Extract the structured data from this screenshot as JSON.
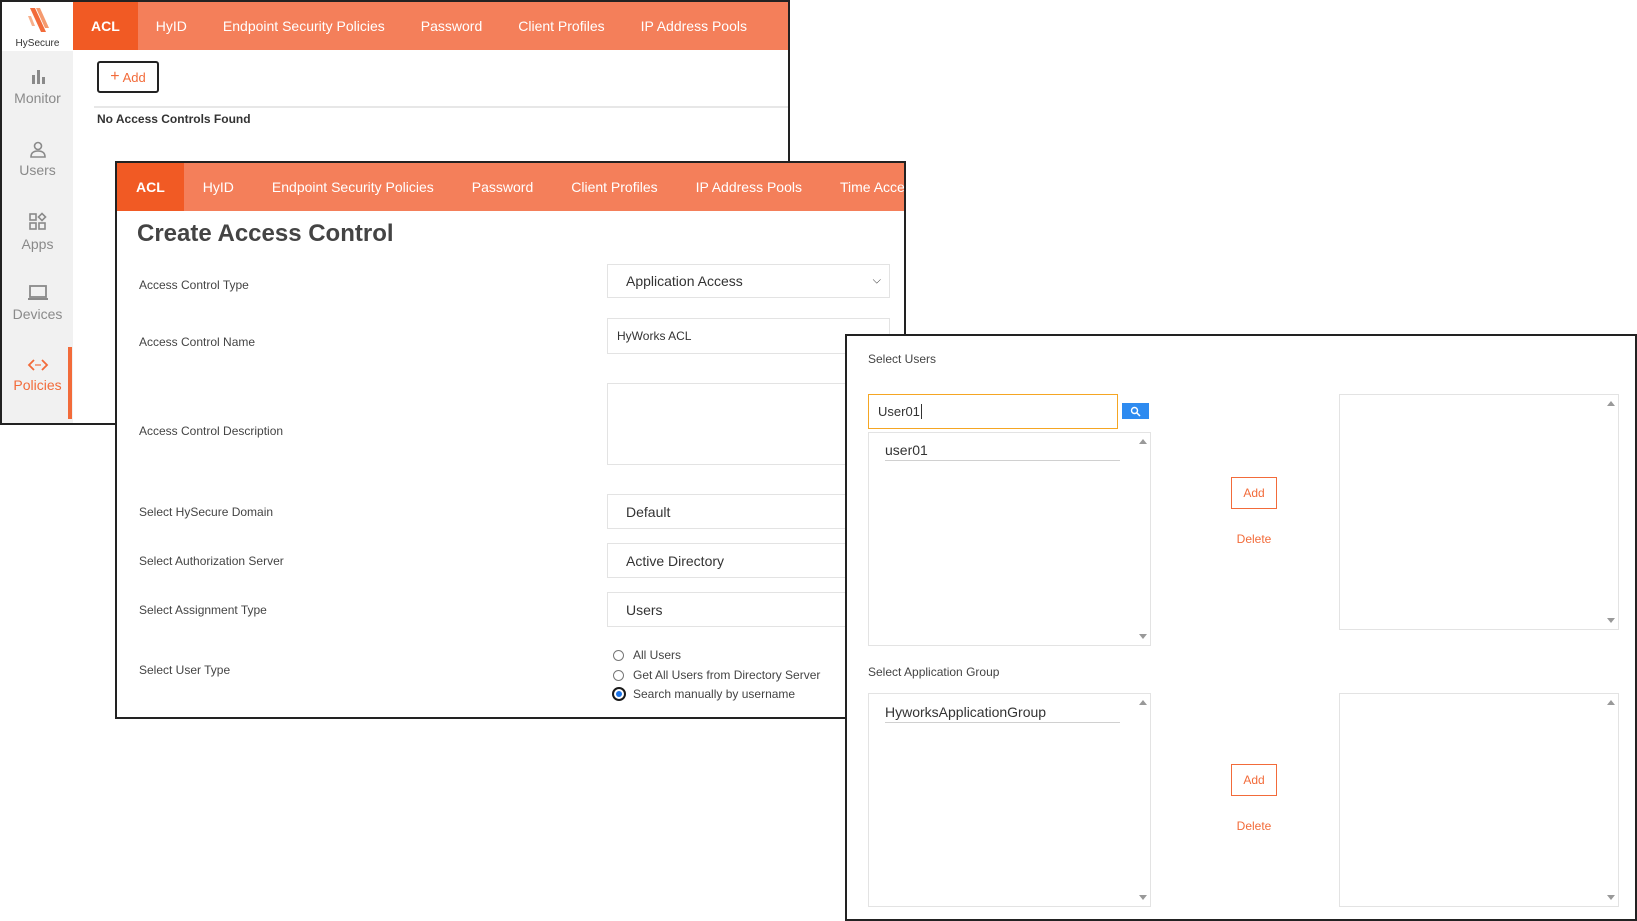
{
  "panel1": {
    "logo_text": "HySecure",
    "sidebar": [
      {
        "label": "Monitor",
        "icon": "bar-chart-icon"
      },
      {
        "label": "Users",
        "icon": "user-icon"
      },
      {
        "label": "Apps",
        "icon": "apps-icon"
      },
      {
        "label": "Devices",
        "icon": "laptop-icon"
      },
      {
        "label": "Policies",
        "icon": "code-arrows-icon",
        "active": true
      }
    ],
    "tabs": [
      "ACL",
      "HyID",
      "Endpoint Security Policies",
      "Password",
      "Client Profiles",
      "IP Address Pools"
    ],
    "add_button": "Add",
    "empty_message": "No Access Controls Found"
  },
  "panel2": {
    "tabs": [
      "ACL",
      "HyID",
      "Endpoint Security Policies",
      "Password",
      "Client Profiles",
      "IP Address Pools",
      "Time Acce"
    ],
    "title": "Create Access Control",
    "fields": {
      "type_label": "Access Control Type",
      "type_value": "Application Access",
      "name_label": "Access Control Name",
      "name_value": "HyWorks ACL",
      "desc_label": "Access Control Description",
      "domain_label": "Select HySecure Domain",
      "domain_value": "Default",
      "auth_label": "Select Authorization Server",
      "auth_value": "Active Directory",
      "assign_label": "Select Assignment Type",
      "assign_value": "Users",
      "usertype_label": "Select User Type"
    },
    "user_type_options": [
      "All Users",
      "Get All Users from Directory Server",
      "Search manually by username"
    ],
    "user_type_selected": "Search manually by username"
  },
  "panel3": {
    "select_users_label": "Select Users",
    "search_value": "User01",
    "search_results": [
      "user01"
    ],
    "add_label": "Add",
    "delete_label": "Delete",
    "select_group_label": "Select Application Group",
    "groups": [
      "HyworksApplicationGroup"
    ]
  },
  "colors": {
    "accent": "#f15a24",
    "tabbar": "#f47f5a",
    "search_button": "#2e8bf0",
    "input_focus": "#f5a623"
  }
}
